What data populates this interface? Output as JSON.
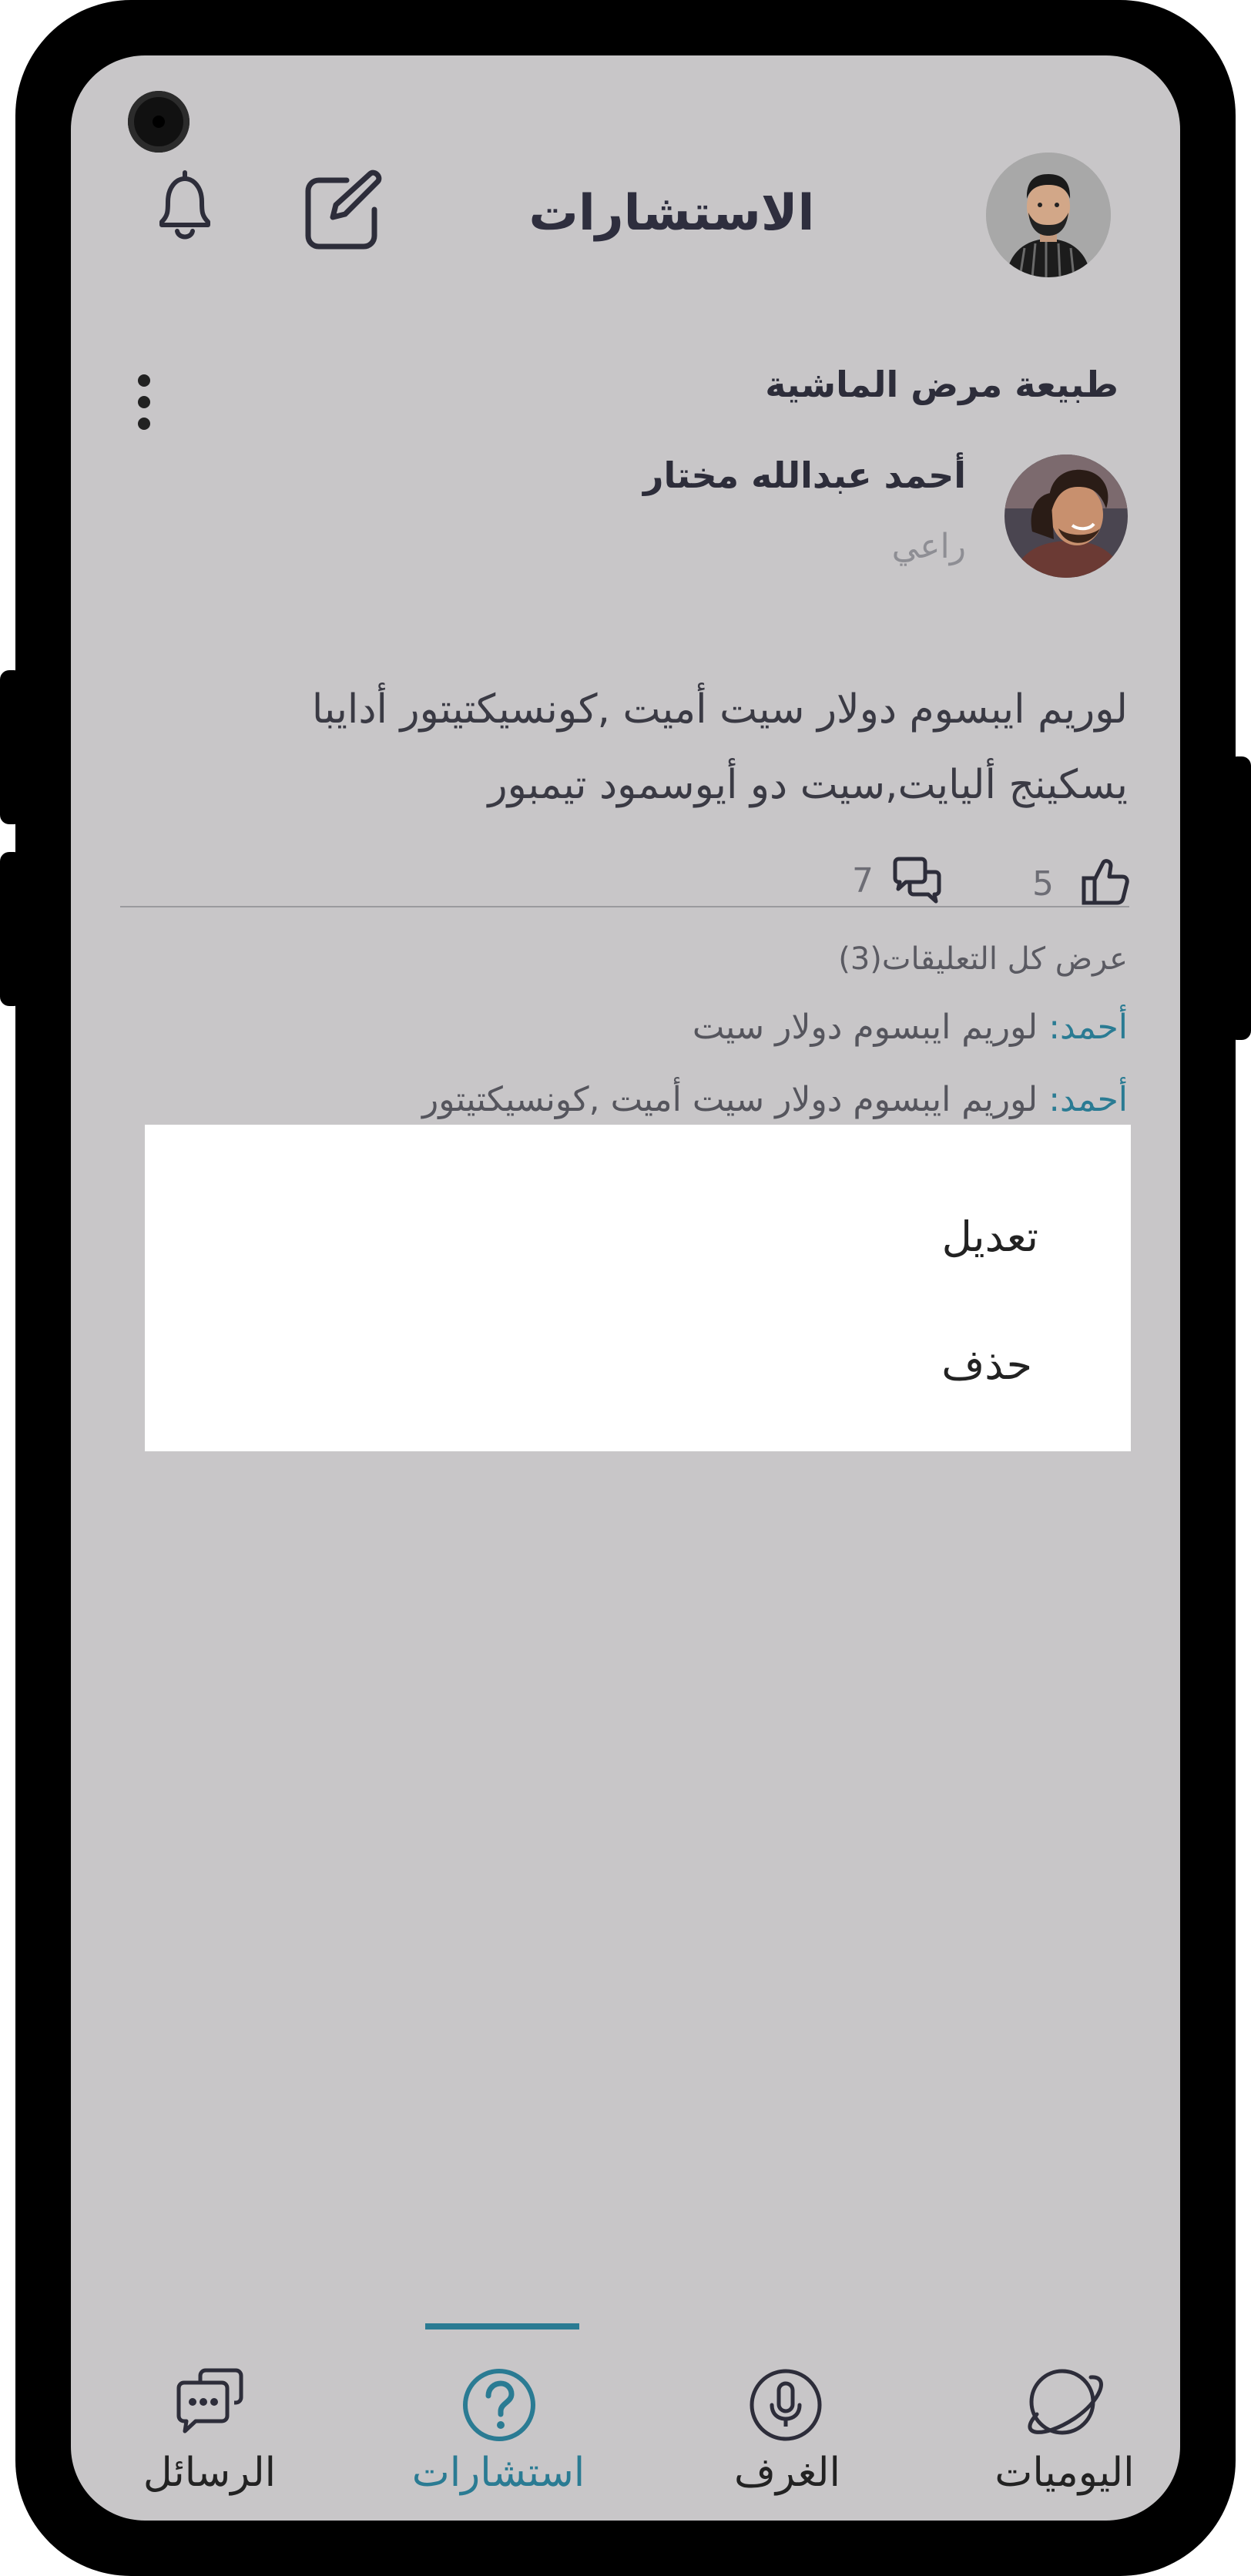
{
  "header": {
    "title": "الاستشارات",
    "icons": [
      "bell-icon",
      "edit-icon",
      "profile-avatar"
    ]
  },
  "post": {
    "title": "طبيعة مرض الماشية",
    "author_name": "أحمد عبدالله مختار",
    "author_role": "راعي",
    "body_line1": "لوريم ايبسوم دولار سيت أميت ,كونسيكتيتور أدايبا",
    "body_line2": "يسكينج أليايت,سيت دو أيوسمود تيمبور",
    "comments_count": "7",
    "likes_count": "5"
  },
  "comments": {
    "view_all": "عرض كل التعليقات(3)",
    "items": [
      {
        "author": "أحمد:",
        "text": "لوريم ايبسوم دولار سيت"
      },
      {
        "author": "أحمد:",
        "text": "لوريم ايبسوم دولار سيت أميت ,كونسيكتيتور"
      }
    ]
  },
  "context_menu": {
    "edit": "تعديل",
    "delete": "حذف"
  },
  "bottom_nav": {
    "items": [
      {
        "label": "الرسائل",
        "icon": "chat-bubbles-icon"
      },
      {
        "label": "استشارات",
        "icon": "question-circle-icon",
        "active": true
      },
      {
        "label": "الغرف",
        "icon": "microphone-icon"
      },
      {
        "label": "اليوميات",
        "icon": "planet-icon"
      }
    ]
  },
  "colors": {
    "screen_bg": "#c8c6c8",
    "accent": "#2a7b93",
    "text": "#2d2d3a"
  }
}
